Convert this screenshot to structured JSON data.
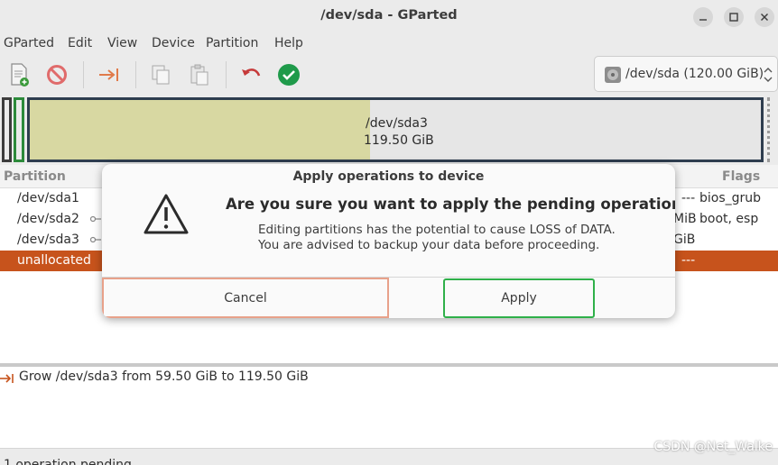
{
  "window": {
    "title": "/dev/sda - GParted"
  },
  "menu": [
    "GParted",
    "Edit",
    "View",
    "Device",
    "Partition",
    "Help"
  ],
  "toolbar": {
    "device_label": "/dev/sda (120.00 GiB)"
  },
  "disk_graphic": {
    "partition_name": "/dev/sda3",
    "partition_size": "119.50 GiB"
  },
  "partition_list": {
    "headers": {
      "partition": "Partition",
      "flags": "Flags"
    },
    "rows": [
      {
        "name": "/dev/sda1",
        "right": "---",
        "flags": "bios_grub"
      },
      {
        "name": "/dev/sda2",
        "right": "MiB",
        "flags": "boot, esp"
      },
      {
        "name": "/dev/sda3",
        "right": "GiB",
        "flags": ""
      },
      {
        "name": "unallocated",
        "right": "---",
        "flags": ""
      }
    ]
  },
  "operations": {
    "items": [
      "Grow /dev/sda3 from 59.50 GiB to 119.50 GiB"
    ]
  },
  "status": {
    "text": "1 operation pending"
  },
  "dialog": {
    "title": "Apply operations to device",
    "heading": "Are you sure you want to apply the pending operations?",
    "line1": "Editing partitions has the potential to cause LOSS of DATA.",
    "line2": "You are advised to backup your data before proceeding.",
    "cancel_label": "Cancel",
    "apply_label": "Apply"
  },
  "watermark": "CSDN @Net_Walke",
  "colors": {
    "selected_row": "#c7531c",
    "used_space": "#d8d8a2",
    "apply_border": "#2fb04a",
    "cancel_border": "#e8a18a",
    "grow_arrow": "#c7531c"
  }
}
